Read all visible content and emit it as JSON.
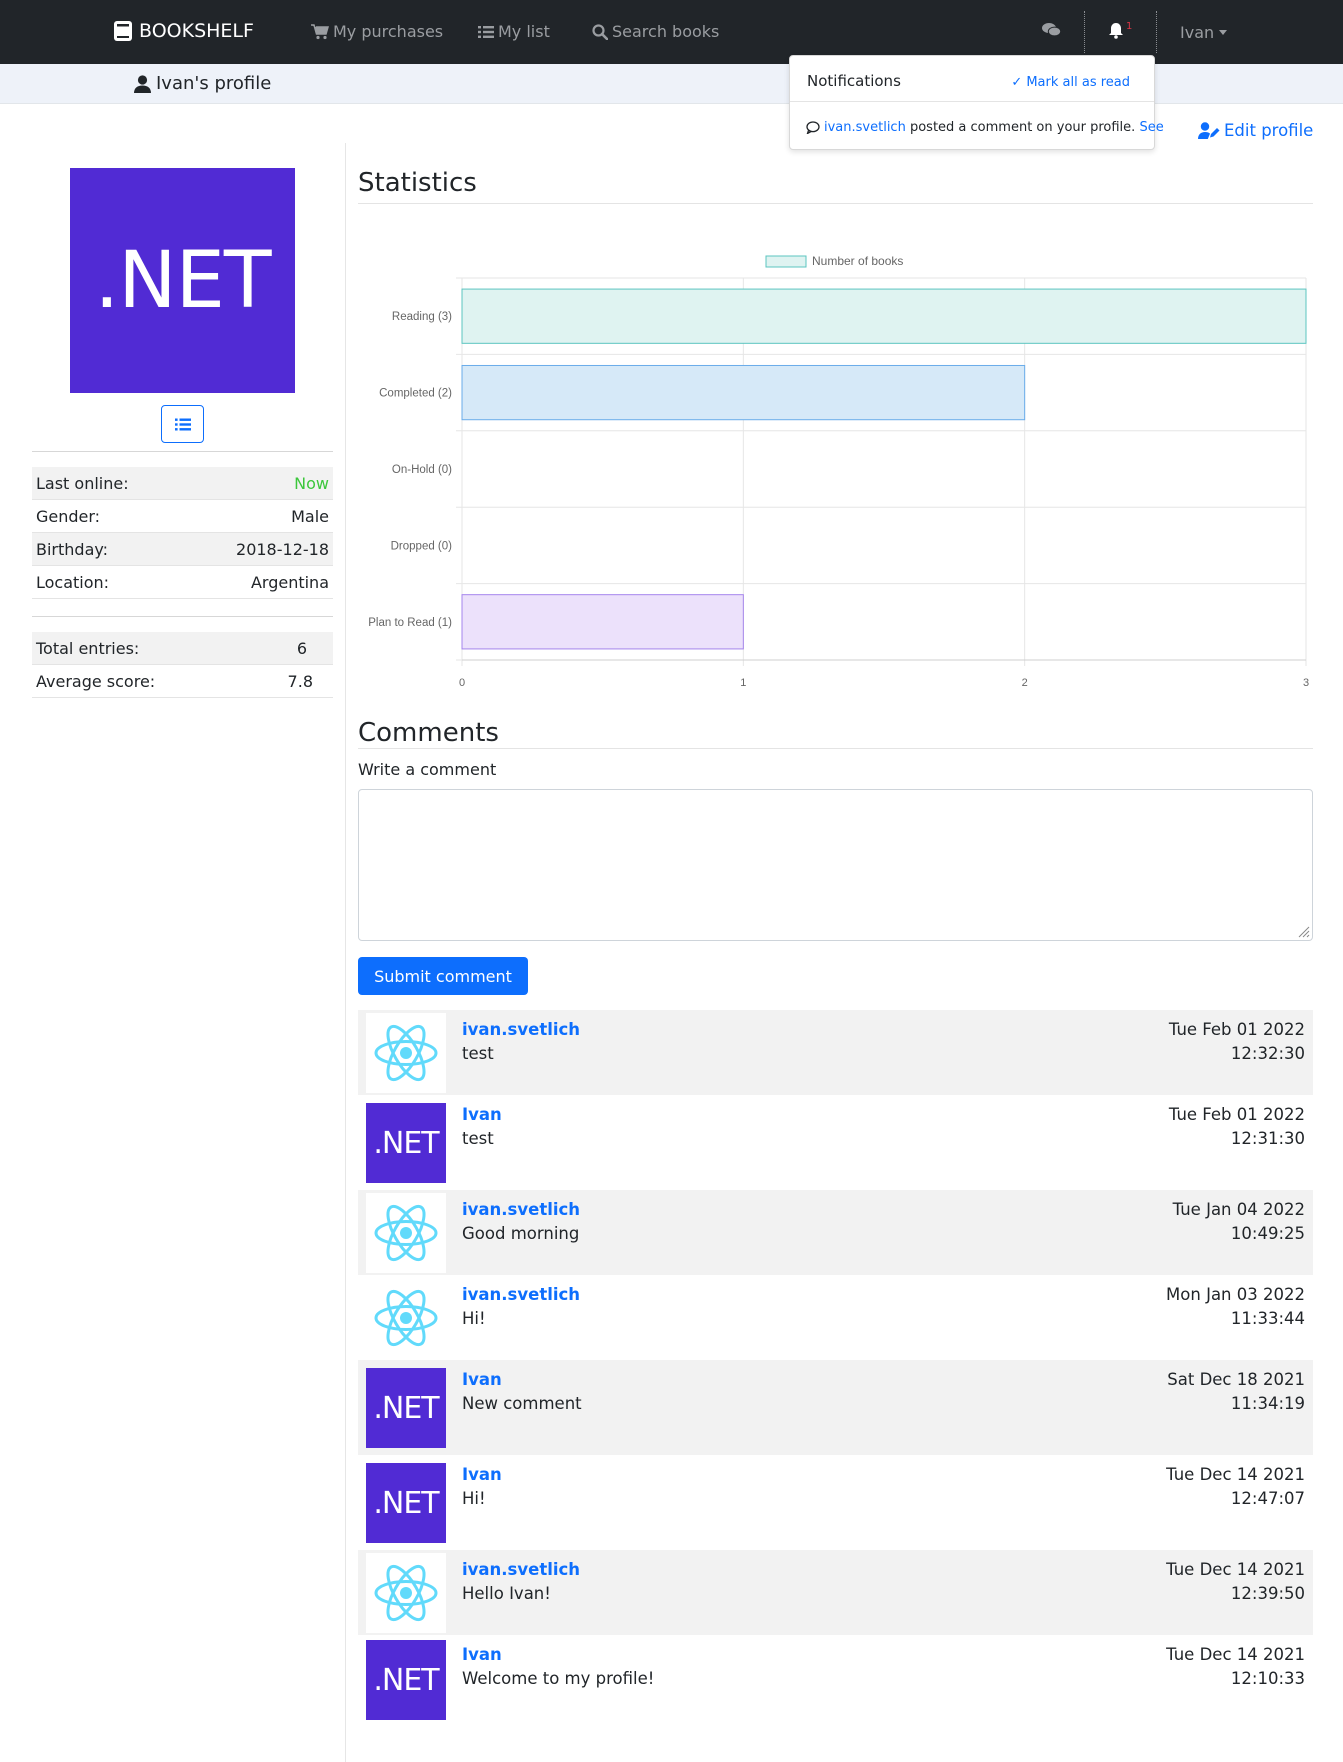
{
  "navbar": {
    "brand": "BOOKSHELF",
    "links": [
      "My purchases",
      "My list",
      "Search books"
    ],
    "notification_count": "1",
    "user_name": "Ivan"
  },
  "page_title": "Ivan's profile",
  "notifications": {
    "title": "Notifications",
    "mark_all": "✓ Mark all as read",
    "item_user": "ivan.svetlich",
    "item_text": "posted a comment on your profile.",
    "item_link": "See"
  },
  "edit_profile": "Edit profile",
  "profile": {
    "avatar_text": ".NET",
    "info": [
      {
        "key": "Last online:",
        "value": "Now"
      },
      {
        "key": "Gender:",
        "value": "Male"
      },
      {
        "key": "Birthday:",
        "value": "2018-12-18"
      },
      {
        "key": "Location:",
        "value": "Argentina"
      }
    ],
    "stats": [
      {
        "key": "Total entries:",
        "value": "6"
      },
      {
        "key": "Average score:",
        "value": "7.8"
      }
    ]
  },
  "statistics_title": "Statistics",
  "chart_data": {
    "type": "bar",
    "orientation": "horizontal",
    "categories": [
      "Reading (3)",
      "Completed (2)",
      "On-Hold (0)",
      "Dropped (0)",
      "Plan to Read (1)"
    ],
    "series": [
      {
        "name": "Number of books",
        "values": [
          3,
          2,
          0,
          0,
          1
        ]
      }
    ],
    "xlim": [
      0,
      3
    ],
    "x_ticks": [
      "0",
      "1",
      "2",
      "3"
    ],
    "grid": true,
    "legend_position": "top",
    "colors": {
      "fills": [
        "#dff3f1",
        "#d6e9f8",
        "#fde4e8",
        "#fff2d6",
        "#ece1fb"
      ],
      "borders": [
        "#5bc5c0",
        "#6aacea",
        "#ee8fa0",
        "#f5c36b",
        "#a585ec"
      ]
    }
  },
  "comments_title": "Comments",
  "write_label": "Write a comment",
  "submit_label": "Submit comment",
  "comments": [
    {
      "user": "ivan.svetlich",
      "avatar": "react",
      "text": "test",
      "date": "Tue Feb 01 2022",
      "time": "12:32:30"
    },
    {
      "user": "Ivan",
      "avatar": "net",
      "text": "test",
      "date": "Tue Feb 01 2022",
      "time": "12:31:30"
    },
    {
      "user": "ivan.svetlich",
      "avatar": "react",
      "text": "Good morning",
      "date": "Tue Jan 04 2022",
      "time": "10:49:25"
    },
    {
      "user": "ivan.svetlich",
      "avatar": "react",
      "text": "Hi!",
      "date": "Mon Jan 03 2022",
      "time": "11:33:44"
    },
    {
      "user": "Ivan",
      "avatar": "net",
      "text": "New comment",
      "date": "Sat Dec 18 2021",
      "time": "11:34:19"
    },
    {
      "user": "Ivan",
      "avatar": "net",
      "text": "Hi!",
      "date": "Tue Dec 14 2021",
      "time": "12:47:07"
    },
    {
      "user": "ivan.svetlich",
      "avatar": "react",
      "text": "Hello Ivan!",
      "date": "Tue Dec 14 2021",
      "time": "12:39:50"
    },
    {
      "user": "Ivan",
      "avatar": "net",
      "text": "Welcome to my profile!",
      "date": "Tue Dec 14 2021",
      "time": "12:10:33"
    }
  ],
  "colors": {
    "navbar": "#212529",
    "accent": "#0d6efd",
    "dotnet": "#512bd4",
    "react": "#61dafb",
    "online": "#3cc73c"
  },
  "icons": {
    "brand": "book-icon",
    "purchases": "cart-icon",
    "list": "list-icon",
    "search": "search-icon",
    "chat": "comments-icon",
    "bell": "bell-icon",
    "profile": "user-icon",
    "edit": "user-edit-icon",
    "comment": "comment-icon"
  }
}
